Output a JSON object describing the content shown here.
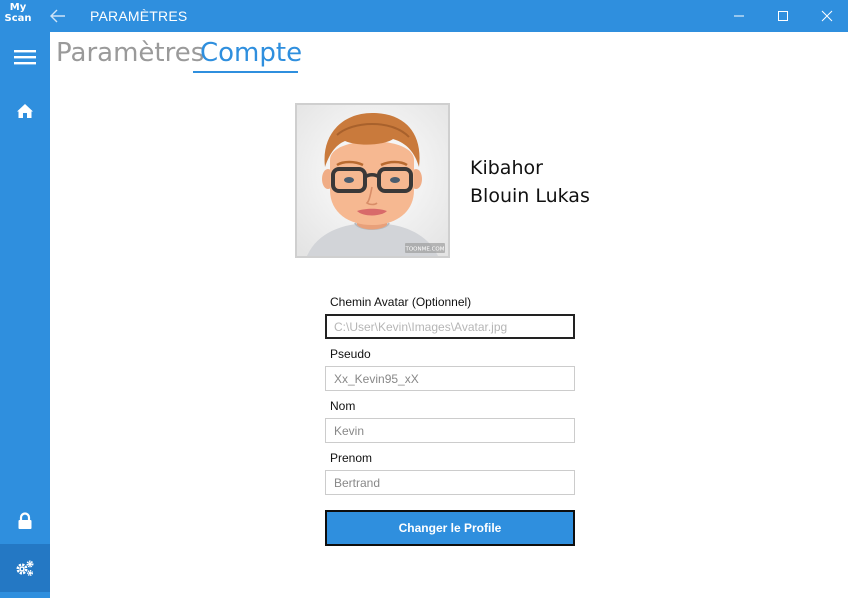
{
  "app": {
    "logo_line1": "My",
    "logo_line2": "Scan"
  },
  "titlebar": {
    "title": "PARAMÈTRES"
  },
  "tabs": [
    {
      "label": "Paramètres",
      "active": false
    },
    {
      "label": "Compte",
      "active": true
    }
  ],
  "profile": {
    "pseudo": "Kibahor",
    "full_name": "Blouin Lukas",
    "avatar_watermark": "TOONME.COM"
  },
  "form": {
    "avatar_path": {
      "label": "Chemin Avatar (Optionnel)",
      "placeholder": "C:\\User\\Kevin\\Images\\Avatar.jpg",
      "value": ""
    },
    "pseudo": {
      "label": "Pseudo",
      "value": "Xx_Kevin95_xX"
    },
    "nom": {
      "label": "Nom",
      "value": "Kevin"
    },
    "prenom": {
      "label": "Prenom",
      "value": "Bertrand"
    },
    "submit_label": "Changer le Profile"
  },
  "colors": {
    "accent": "#2f8fde",
    "accent_dark": "#2478c4",
    "inactive_tab": "#9a9a9a"
  },
  "icons": {
    "menu": "hamburger-icon",
    "home": "home-icon",
    "lock": "lock-icon",
    "settings": "gears-icon",
    "back": "arrow-left-icon"
  }
}
